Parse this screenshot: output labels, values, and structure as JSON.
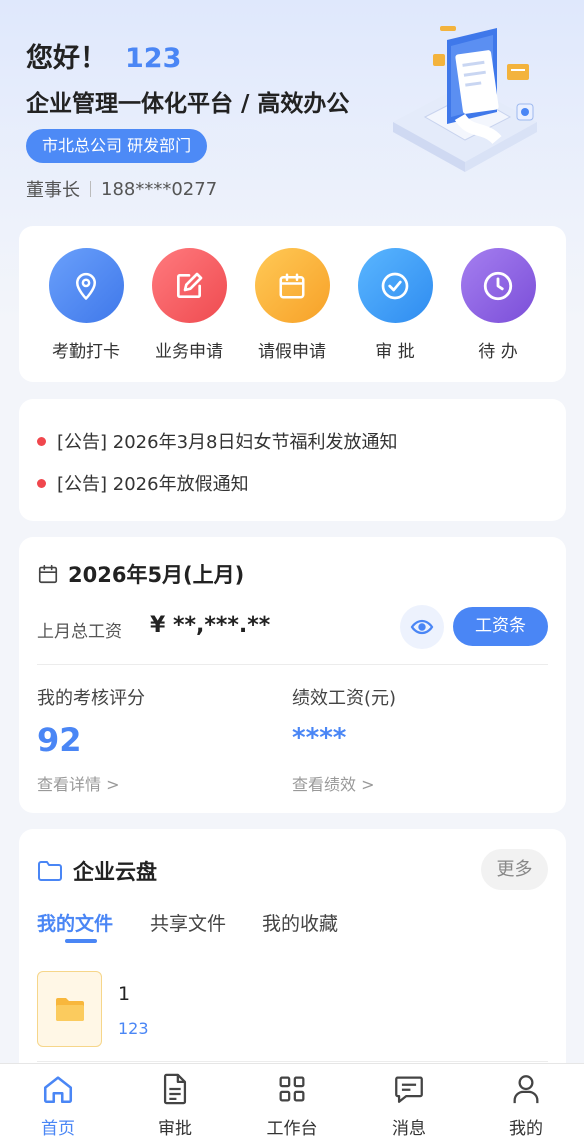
{
  "header": {
    "greeting": "您好！",
    "username": "123",
    "slogan": "企业管理一体化平台 / 高效办公",
    "org": "市北总公司 研发部门",
    "role": "董事长",
    "phone": "188****0277"
  },
  "quick_actions": [
    {
      "label": "考勤打卡",
      "icon": "location-pin-icon",
      "color": "#4a86f5"
    },
    {
      "label": "业务申请",
      "icon": "edit-icon",
      "color": "#f5555a"
    },
    {
      "label": "请假申请",
      "icon": "calendar-icon",
      "color": "#fbb23a"
    },
    {
      "label": "审 批",
      "icon": "check-circle-icon",
      "color": "#3c9bf5"
    },
    {
      "label": "待 办",
      "icon": "clock-icon",
      "color": "#8c5ce0"
    }
  ],
  "notices": [
    {
      "text": "[公告] 2026年3月8日妇女节福利发放通知"
    },
    {
      "text": "[公告] 2026年放假通知"
    }
  ],
  "salary": {
    "period": "2026年5月(上月)",
    "total_label": "上月总工资",
    "total_value": "¥ **,***.**",
    "payslip_button": "工资条",
    "score_label": "我的考核评分",
    "score_value": "92",
    "score_link": "查看详情 >",
    "perf_label": "绩效工资(元)",
    "perf_value": "****",
    "perf_link": "查看绩效 >"
  },
  "cloud": {
    "title": "企业云盘",
    "more_button": "更多",
    "tabs": [
      "我的文件",
      "共享文件",
      "我的收藏"
    ],
    "active_tab": 0,
    "files": [
      {
        "name": "1",
        "meta": "123",
        "icon": "folder-icon"
      }
    ]
  },
  "tabbar": {
    "items": [
      {
        "label": "首页",
        "icon": "home-icon"
      },
      {
        "label": "审批",
        "icon": "document-icon"
      },
      {
        "label": "工作台",
        "icon": "grid-icon"
      },
      {
        "label": "消息",
        "icon": "message-icon"
      },
      {
        "label": "我的",
        "icon": "user-icon"
      }
    ],
    "active": 0
  },
  "colors": {
    "accent": "#4a86f5",
    "notice_dot": "#f0474d"
  }
}
